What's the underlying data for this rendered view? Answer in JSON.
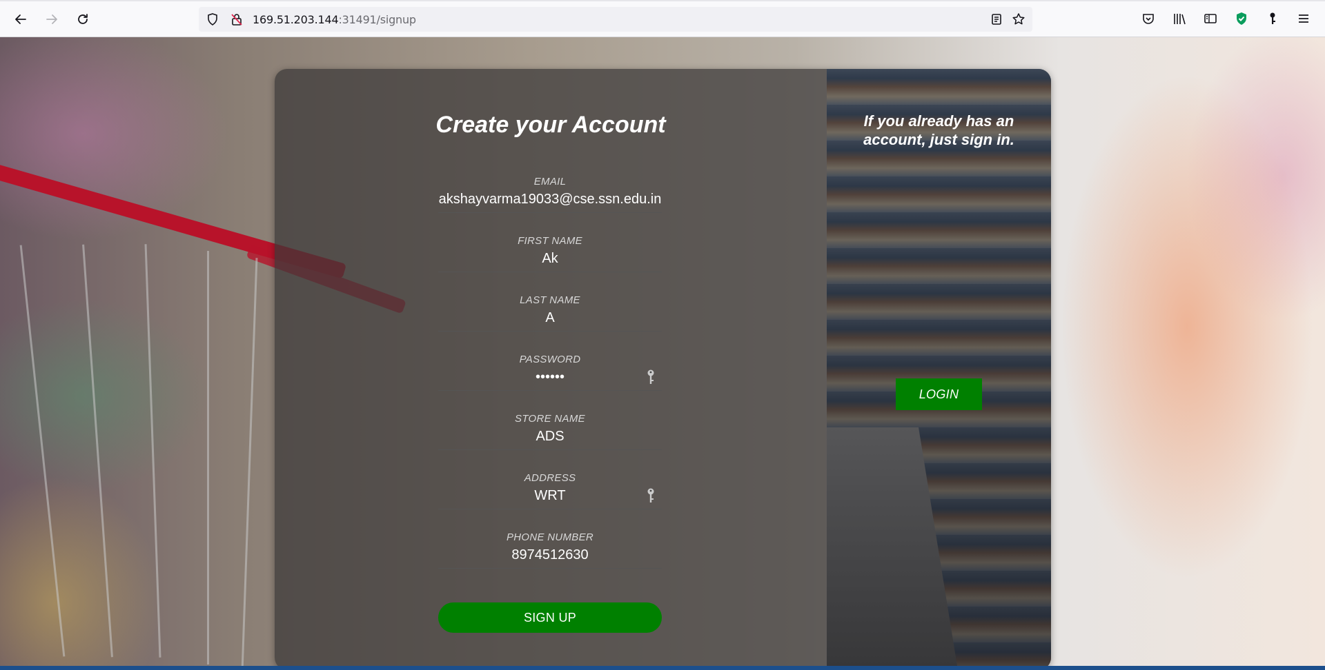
{
  "browser": {
    "url_host": "169.51.203.144",
    "url_rest": ":31491/signup"
  },
  "form": {
    "title": "Create your Account",
    "fields": [
      {
        "label": "EMAIL",
        "value": "akshayvarma19033@cse.ssn.edu.in"
      },
      {
        "label": "FIRST NAME",
        "value": "Ak"
      },
      {
        "label": "LAST NAME",
        "value": "A"
      },
      {
        "label": "PASSWORD",
        "value": "••••••"
      },
      {
        "label": "STORE NAME",
        "value": "ADS"
      },
      {
        "label": "ADDRESS",
        "value": "WRT"
      },
      {
        "label": "PHONE NUMBER",
        "value": "8974512630"
      }
    ],
    "submit_label": "SIGN UP"
  },
  "side": {
    "title": "If you already has an account, just sign in.",
    "login_label": "LOGIN"
  },
  "colors": {
    "button_green": "#008000",
    "panel_dark": "#3a3838"
  }
}
